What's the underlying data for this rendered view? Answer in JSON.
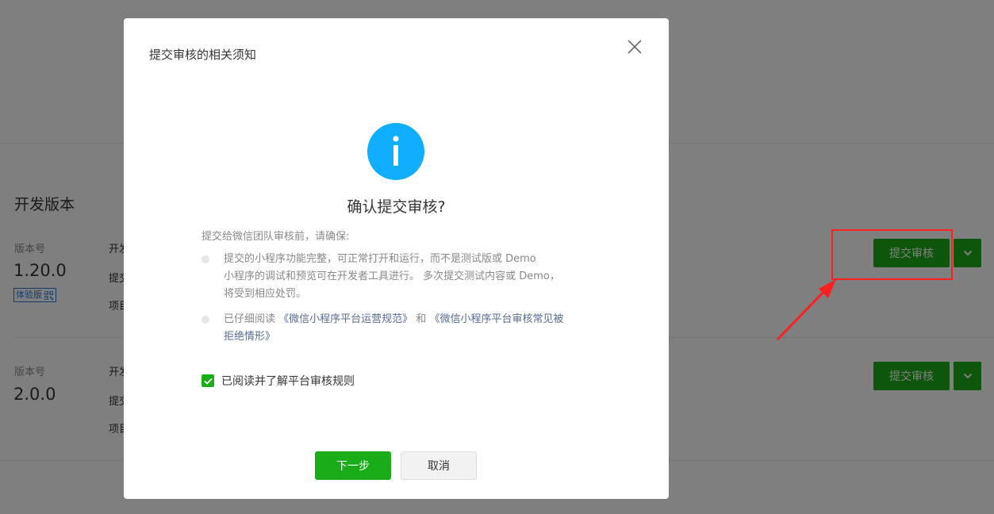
{
  "page": {
    "section_title": "开发版本",
    "versions": [
      {
        "version_label": "版本号",
        "version_number": "1.20.0",
        "badge": "体验版",
        "meta": [
          "开发者",
          "提交时间",
          "项目备注"
        ],
        "submit_label": "提交审核"
      },
      {
        "version_label": "版本号",
        "version_number": "2.0.0",
        "meta": [
          "开发者",
          "提交时间",
          "项目备注"
        ],
        "submit_label": "提交审核"
      }
    ]
  },
  "dialog": {
    "title": "提交审核的相关须知",
    "confirm_title": "确认提交审核?",
    "intro": "提交给微信团队审核前，请确保:",
    "rule1": {
      "line1": "提交的小程序功能完整，可正常打开和运行，而不是测试版或 Demo",
      "line2": "小程序的调试和预览可在开发者工具进行。 多次提交测试内容或 Demo，",
      "line3": "将受到相应处罚。"
    },
    "rule2": {
      "prefix": "已仔细阅读",
      "link1": "《微信小程序平台运营规范》",
      "middle": "和",
      "link2_line1": "《微信小程序平台审核常见被",
      "link2_line2": "拒绝情形》"
    },
    "checkbox_label": "已阅读并了解平台审核规则",
    "checkbox_checked": true,
    "next_label": "下一步",
    "cancel_label": "取消"
  },
  "colors": {
    "accent_green": "#1aad19",
    "info_blue": "#10aeff",
    "link_blue": "#576b95",
    "annotation_red": "#ff1f1f"
  },
  "icons": [
    "close-icon",
    "info-icon",
    "qr-code-icon",
    "chevron-down-icon",
    "check-icon"
  ]
}
